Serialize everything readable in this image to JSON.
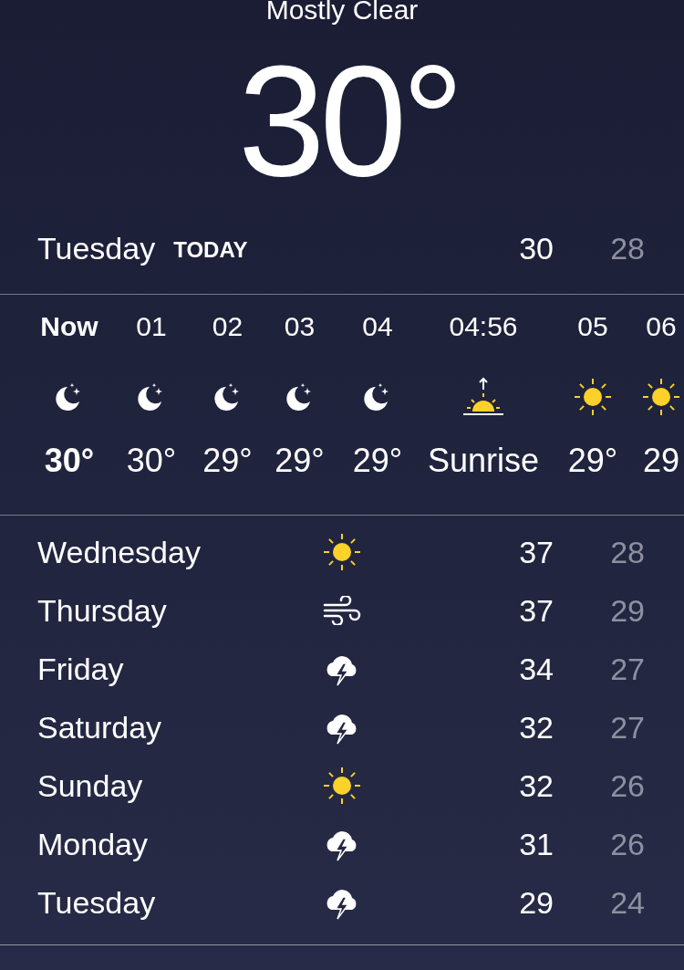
{
  "current": {
    "condition": "Mostly Clear",
    "temperature": "30°"
  },
  "today": {
    "day": "Tuesday",
    "label": "TODAY",
    "high": "30",
    "low": "28"
  },
  "hourly": [
    {
      "kind": "moon",
      "selected": true,
      "time": "Now",
      "temp": "30°"
    },
    {
      "kind": "moon",
      "selected": false,
      "time": "01",
      "temp": "30°"
    },
    {
      "kind": "moon",
      "selected": false,
      "time": "02",
      "temp": "29°"
    },
    {
      "kind": "moon",
      "selected": false,
      "time": "03",
      "temp": "29°"
    },
    {
      "kind": "moon",
      "selected": false,
      "time": "04",
      "temp": "29°"
    },
    {
      "kind": "sunrise",
      "selected": false,
      "time": "04:56",
      "temp": "Sunrise"
    },
    {
      "kind": "sun",
      "selected": false,
      "time": "05",
      "temp": "29°"
    },
    {
      "kind": "sun",
      "selected": false,
      "time": "06",
      "temp": "29"
    }
  ],
  "daily": [
    {
      "kind": "sun",
      "day": "Wednesday",
      "high": "37",
      "low": "28"
    },
    {
      "kind": "wind",
      "day": "Thursday",
      "high": "37",
      "low": "29"
    },
    {
      "kind": "storm",
      "day": "Friday",
      "high": "34",
      "low": "27"
    },
    {
      "kind": "storm",
      "day": "Saturday",
      "high": "32",
      "low": "27"
    },
    {
      "kind": "sun",
      "day": "Sunday",
      "high": "32",
      "low": "26"
    },
    {
      "kind": "storm",
      "day": "Monday",
      "high": "31",
      "low": "26"
    },
    {
      "kind": "storm",
      "day": "Tuesday",
      "high": "29",
      "low": "24"
    }
  ]
}
